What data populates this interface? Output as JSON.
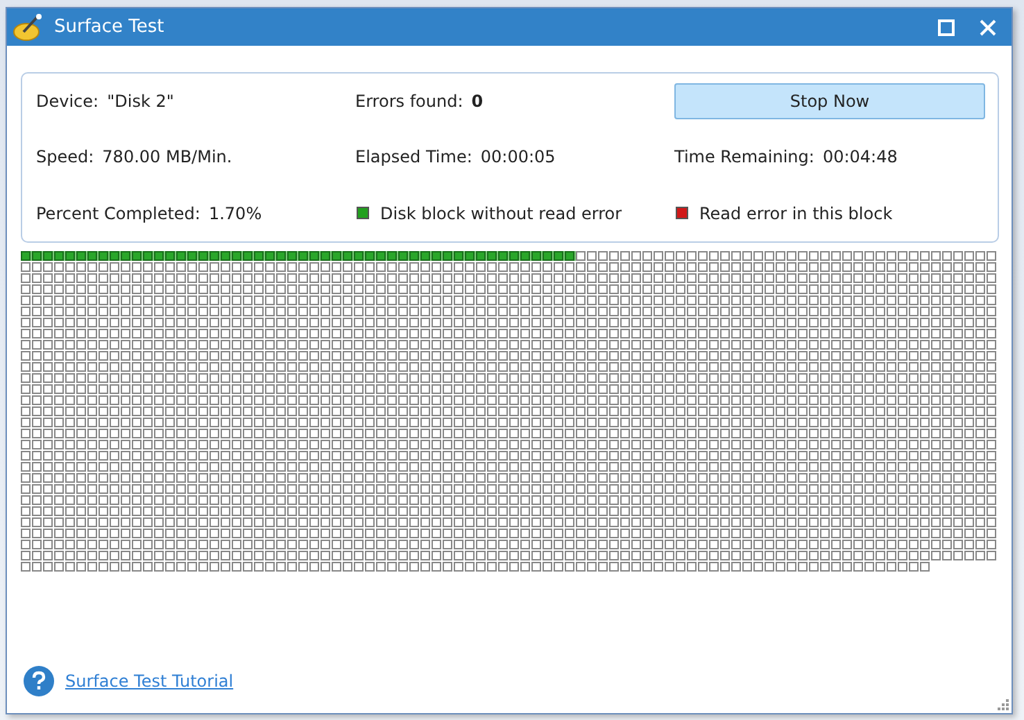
{
  "window": {
    "title": "Surface Test"
  },
  "info": [
    {
      "label": "Device:",
      "value": "\"Disk 2\"",
      "kind": "text"
    },
    {
      "label": "Errors found:",
      "value": "0",
      "kind": "bold"
    },
    {
      "kind": "button",
      "label": "Stop Now"
    },
    {
      "label": "Speed:",
      "value": "780.00 MB/Min.",
      "kind": "text"
    },
    {
      "label": "Elapsed Time:",
      "value": "00:00:05",
      "kind": "text"
    },
    {
      "label": "Time Remaining:",
      "value": "00:04:48",
      "kind": "text"
    },
    {
      "label": "Percent Completed:",
      "value": "1.70%",
      "kind": "text"
    },
    {
      "kind": "legend",
      "label": "Disk block without read error",
      "color": "#22a01e"
    },
    {
      "kind": "legend",
      "label": "Read error in this block",
      "color": "#d01818"
    }
  ],
  "scanned_row": {
    "level": 0.568
  },
  "tutorial_link": "Surface Test Tutorial"
}
